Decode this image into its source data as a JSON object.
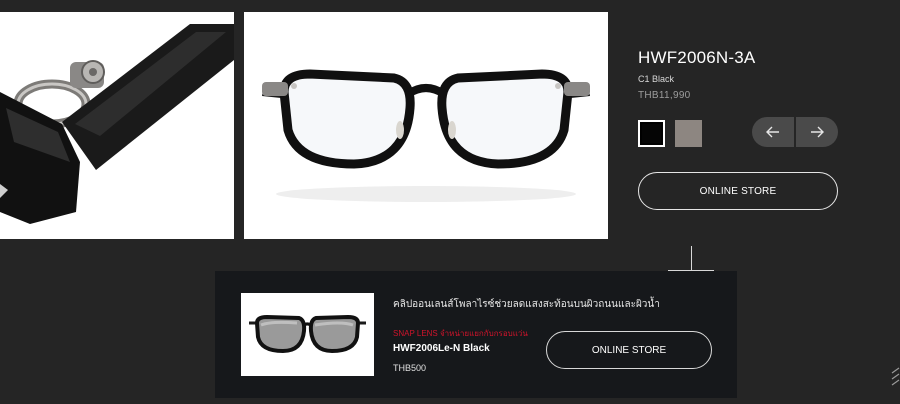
{
  "product": {
    "model": "HWF2006N-3A",
    "color_name": "C1 Black",
    "price": "THB11,990",
    "swatches": [
      {
        "name": "black",
        "color": "#050505",
        "selected": true
      },
      {
        "name": "grey",
        "color": "#8d8681",
        "selected": false
      }
    ],
    "online_store_label": "ONLINE STORE"
  },
  "gallery": {
    "prev_icon": "arrow-left-icon",
    "next_icon": "arrow-right-icon"
  },
  "promo": {
    "headline": "คลิปออนเลนส์โพลาไรซ์ช่วยลดแสงสะท้อนบนผิวถนนและผิวน้ำ",
    "tag": "SNAP LENS จำหน่ายแยกกับกรอบแว่น",
    "model": "HWF2006Le-N Black",
    "price": "THB500",
    "online_store_label": "ONLINE STORE"
  },
  "colors": {
    "background": "#252525",
    "promo_background": "#16181b",
    "accent_red": "#d0142b"
  }
}
